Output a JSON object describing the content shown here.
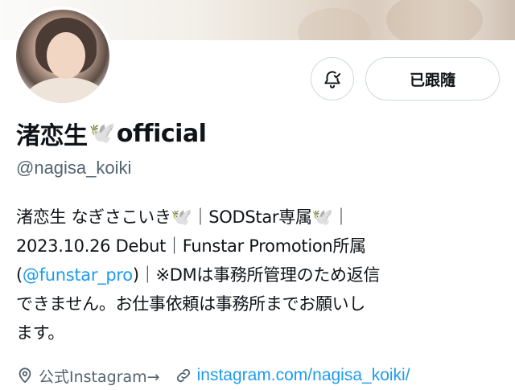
{
  "profile": {
    "display_name": "渚恋生",
    "display_name_suffix": "official",
    "handle": "@nagisa_koiki",
    "dove_emoji": "🕊️"
  },
  "actions": {
    "notify_icon": "bell-check-icon",
    "follow_label": "已跟隨"
  },
  "bio": {
    "line1_a": "渚恋生 なぎさこいき",
    "line1_b": "｜SODStar専属",
    "line1_c": "｜",
    "line2": "2023.10.26 Debut｜Funstar Promotion所属",
    "line3_open": "(",
    "line3_mention": "@funstar_pro",
    "line3_rest": ")｜※DMは事務所管理のため返信",
    "line4": "できません。お仕事依頼は事務所までお願いし",
    "line5": "ます。"
  },
  "meta": {
    "location_icon": "location-pin-icon",
    "location_text": "公式Instagram→",
    "link_icon": "link-icon",
    "link_text": "instagram.com/nagisa_koiki/"
  },
  "colors": {
    "accent": "#1d9bf0",
    "text": "#0f1419",
    "secondary": "#536471",
    "border": "#cfd9de"
  }
}
